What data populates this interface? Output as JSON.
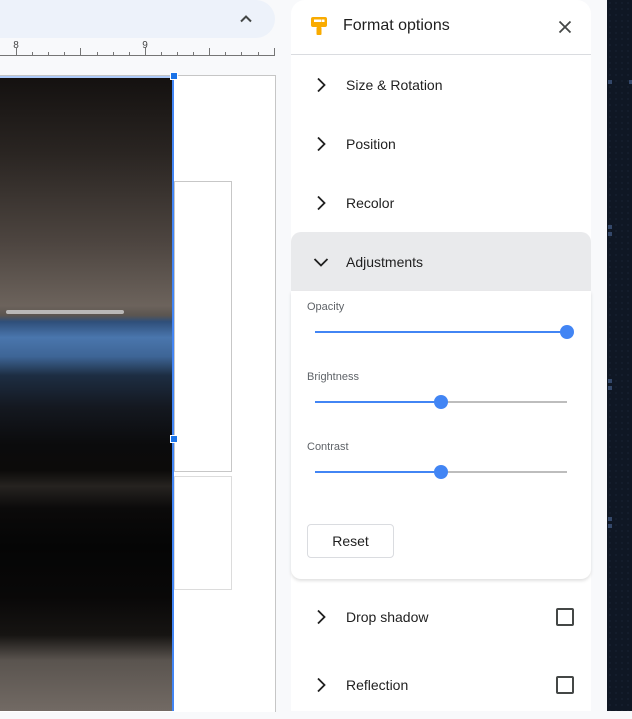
{
  "editor": {
    "collapse_toolbar_icon": "chevron-up-icon",
    "ruler": {
      "labels": [
        "8",
        "9"
      ]
    }
  },
  "panel": {
    "title": "Format options",
    "header_icon": "paint-brush-icon",
    "close_icon": "close-icon",
    "sections": [
      {
        "label": "Size & Rotation",
        "expanded": false
      },
      {
        "label": "Position",
        "expanded": false
      },
      {
        "label": "Recolor",
        "expanded": false
      },
      {
        "label": "Adjustments",
        "expanded": true
      }
    ],
    "adjustments": {
      "opacity": {
        "label": "Opacity",
        "value_percent": 100
      },
      "brightness": {
        "label": "Brightness",
        "value_percent": 50
      },
      "contrast": {
        "label": "Contrast",
        "value_percent": 50
      },
      "reset_label": "Reset"
    },
    "lower_sections": [
      {
        "label": "Drop shadow",
        "checked": false
      },
      {
        "label": "Reflection",
        "checked": false
      }
    ]
  },
  "colors": {
    "accent": "#4285f4",
    "selection_handle": "#1a73e8",
    "brush_icon": "#f9ab00",
    "expanded_section_bg": "#e9eaec"
  }
}
